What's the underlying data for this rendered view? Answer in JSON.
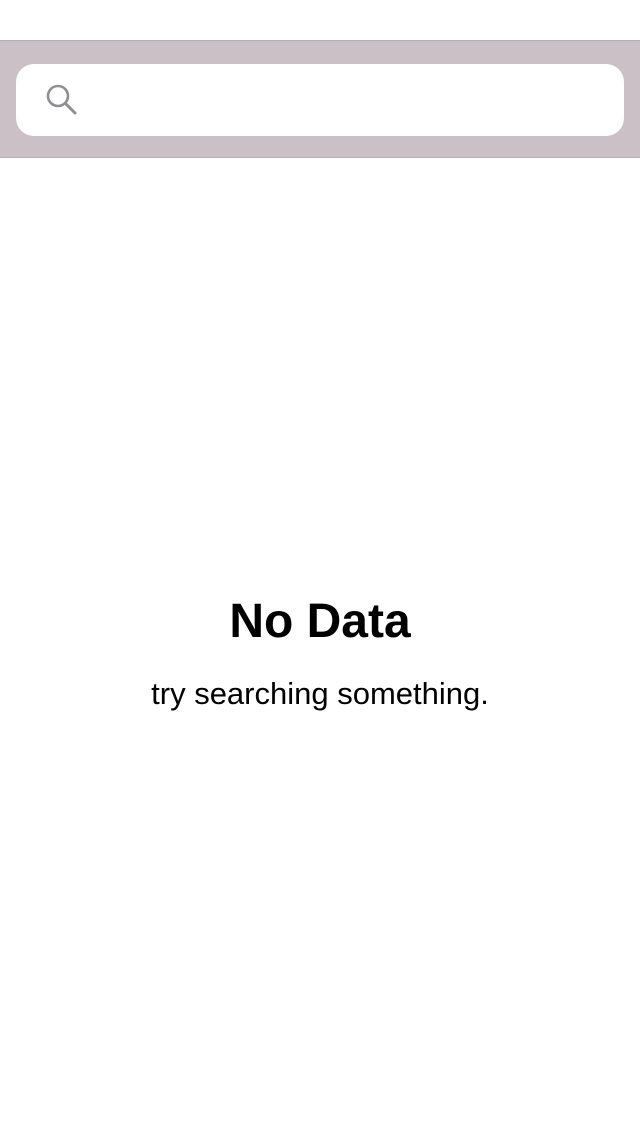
{
  "search": {
    "placeholder": "",
    "value": "",
    "icon": "search-icon",
    "bar_color": "#cbc0c6"
  },
  "empty_state": {
    "title": "No Data",
    "subtitle": "try searching something."
  }
}
